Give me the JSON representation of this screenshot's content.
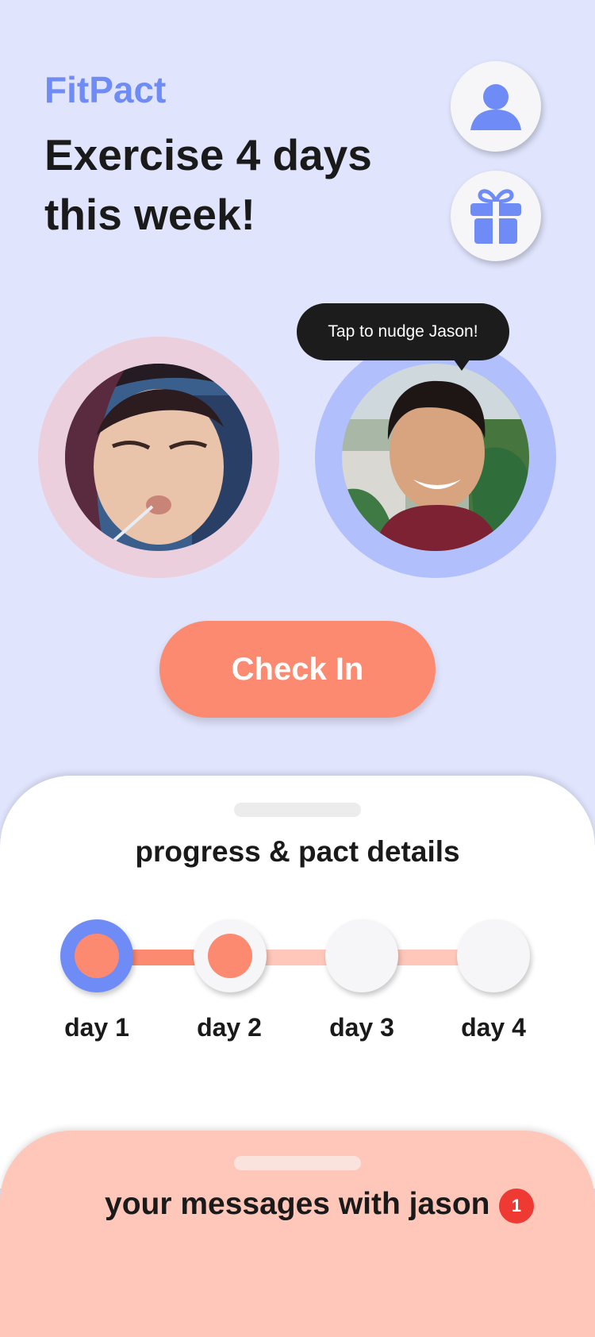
{
  "header": {
    "app_name": "FitPact",
    "goal": "Exercise 4 days this week!"
  },
  "icons": {
    "profile": "person-icon",
    "rewards": "gift-icon"
  },
  "partners": {
    "me": {
      "ring_color": "#ebcfdc",
      "photo": "user-photo"
    },
    "partner": {
      "ring_color": "#b1bffd",
      "photo": "partner-photo",
      "tooltip": "Tap to nudge Jason!"
    }
  },
  "checkin": {
    "label": "Check In"
  },
  "progress": {
    "title": "progress & pact details",
    "days": [
      {
        "label": "day 1",
        "status": "completed-current"
      },
      {
        "label": "day 2",
        "status": "completed"
      },
      {
        "label": "day 3",
        "status": "pending"
      },
      {
        "label": "day 4",
        "status": "pending"
      }
    ]
  },
  "messages": {
    "title": "your messages with jason",
    "unread": "1"
  },
  "colors": {
    "background": "#e0e4fc",
    "accent_blue": "#6f8cf6",
    "accent_coral": "#fc8a70",
    "coral_light": "#fec7ba",
    "badge_red": "#ee3a33"
  }
}
